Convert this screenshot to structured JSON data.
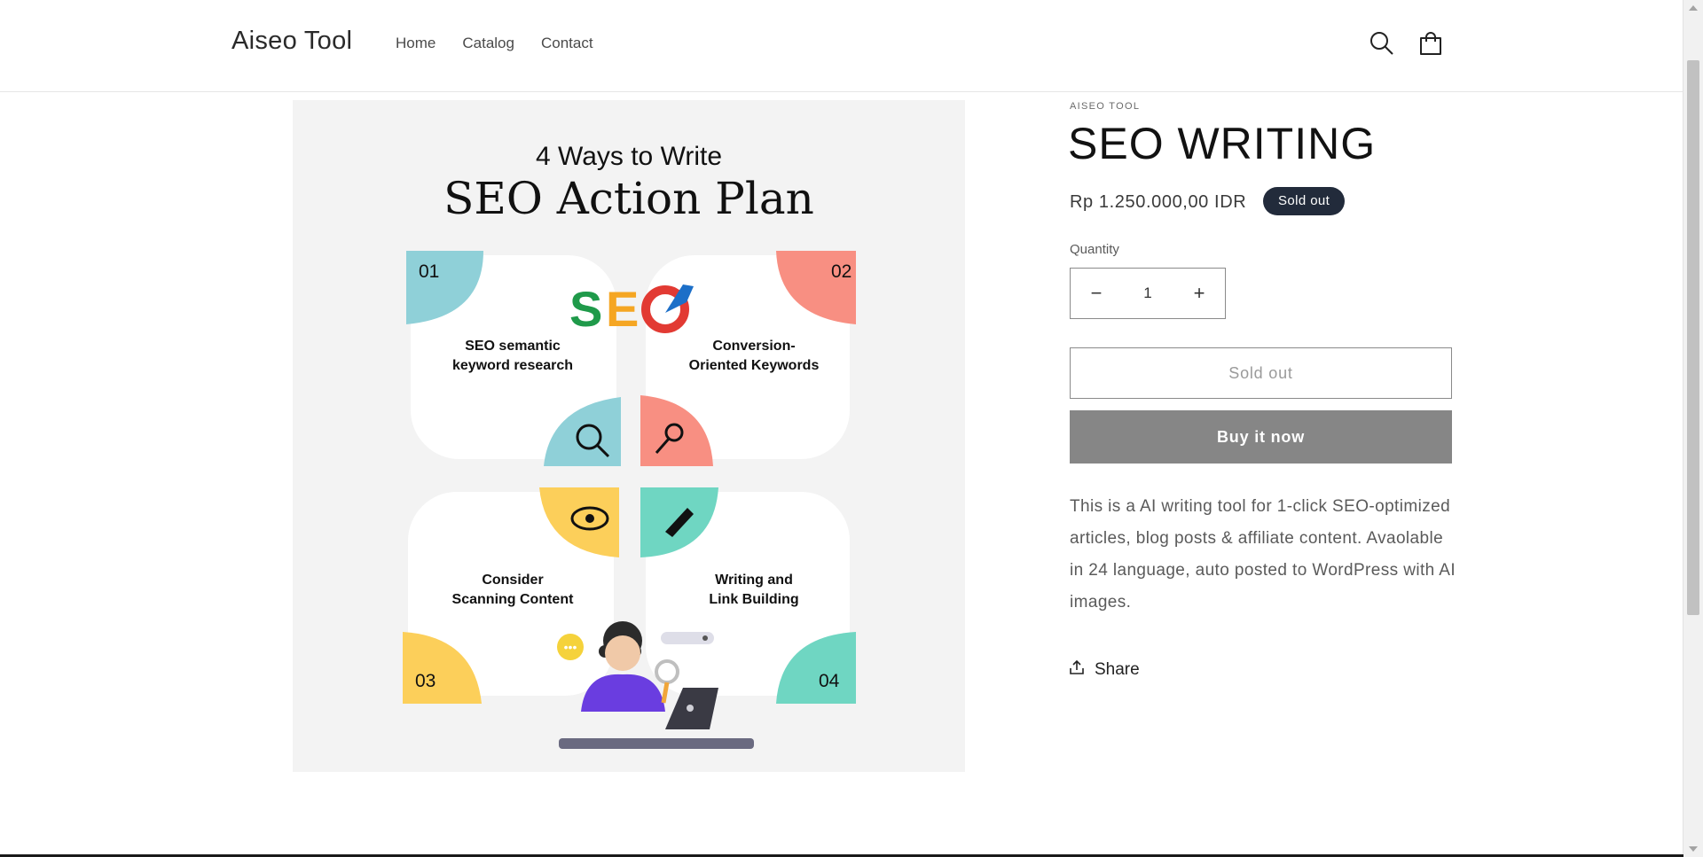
{
  "header": {
    "logo": "Aiseo Tool",
    "nav": [
      "Home",
      "Catalog",
      "Contact"
    ],
    "search_icon": "search-icon",
    "cart_icon": "cart-icon"
  },
  "product": {
    "vendor": "AISEO TOOL",
    "title": "SEO WRITING",
    "price": "Rp 1.250.000,00 IDR",
    "badge": "Sold out",
    "quantity_label": "Quantity",
    "quantity_value": "1",
    "minus_label": "−",
    "plus_label": "+",
    "sold_out_button": "Sold out",
    "buy_now_button": "Buy it now",
    "description": "This is a AI writing tool for 1-click SEO-optimized articles, blog posts & affiliate content. Avaolable in 24 language, auto posted to WordPress with AI images.",
    "share_label": "Share"
  },
  "image": {
    "heading_small": "4 Ways to Write",
    "heading_large": "SEO Action Plan",
    "logo_text": "SEO",
    "cards": [
      {
        "number": "01",
        "line1": "SEO semantic",
        "line2": "keyword  research",
        "color": "#8fd0d8"
      },
      {
        "number": "02",
        "line1": "Conversion-",
        "line2": "Oriented Keywords",
        "color": "#f88f82"
      },
      {
        "number": "03",
        "line1": "Consider",
        "line2": "Scanning Content",
        "color": "#fccf5a"
      },
      {
        "number": "04",
        "line1": "Writing and",
        "line2": "Link Building",
        "color": "#6fd6c2"
      }
    ]
  },
  "colors": {
    "badge_bg": "#222b3b",
    "buy_button_bg": "#868686"
  }
}
